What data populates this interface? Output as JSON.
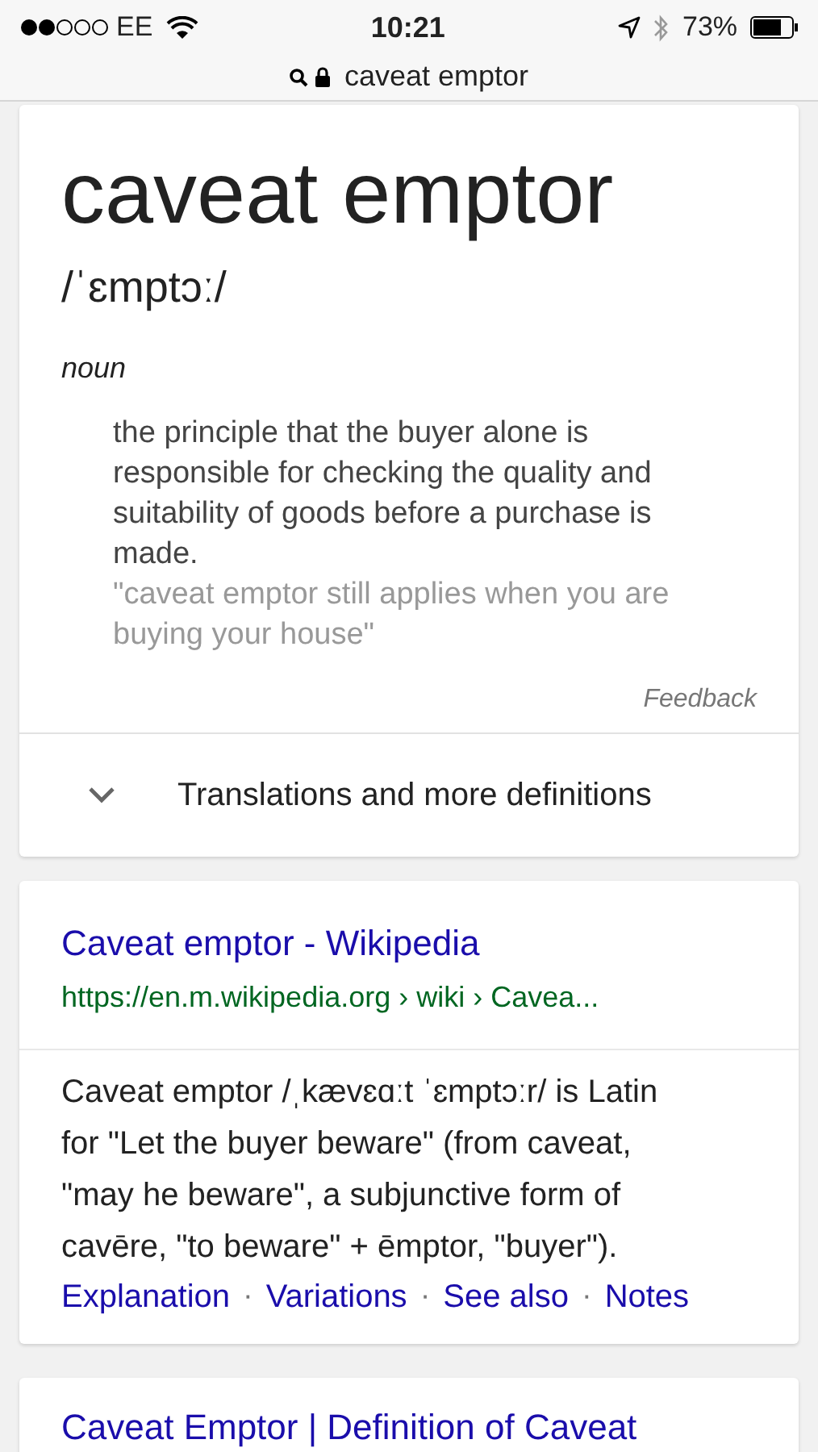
{
  "status_bar": {
    "carrier": "EE",
    "time": "10:21",
    "battery": "73%"
  },
  "address_bar": {
    "text": "caveat emptor"
  },
  "definition_card": {
    "word": "caveat emptor",
    "pronunciation": "/ˈɛmptɔː/",
    "part_of_speech": "noun",
    "definition": "the principle that the buyer alone is responsible for checking the quality and suitability of goods before a purchase is made.",
    "example": "\"caveat emptor still applies when you are buying your house\"",
    "feedback": "Feedback",
    "more": {
      "label": "Translations and more definitions",
      "expanded": false
    }
  },
  "results": [
    {
      "title": "Caveat emptor - Wikipedia",
      "url": "https://en.m.wikipedia.org › wiki › Cavea...",
      "snippet": "Caveat emptor /ˌkævɛɑːt ˈɛmptɔːr/ is Latin for \"Let the buyer beware\" (from caveat, \"may he beware\", a subjunctive form of cavēre, \"to beware\" + ēmptor, \"buyer\").",
      "links": [
        "Explanation",
        "Variations",
        "See also",
        "Notes"
      ],
      "link_separator": "·"
    },
    {
      "title": "Caveat Emptor | Definition of Caveat"
    }
  ]
}
